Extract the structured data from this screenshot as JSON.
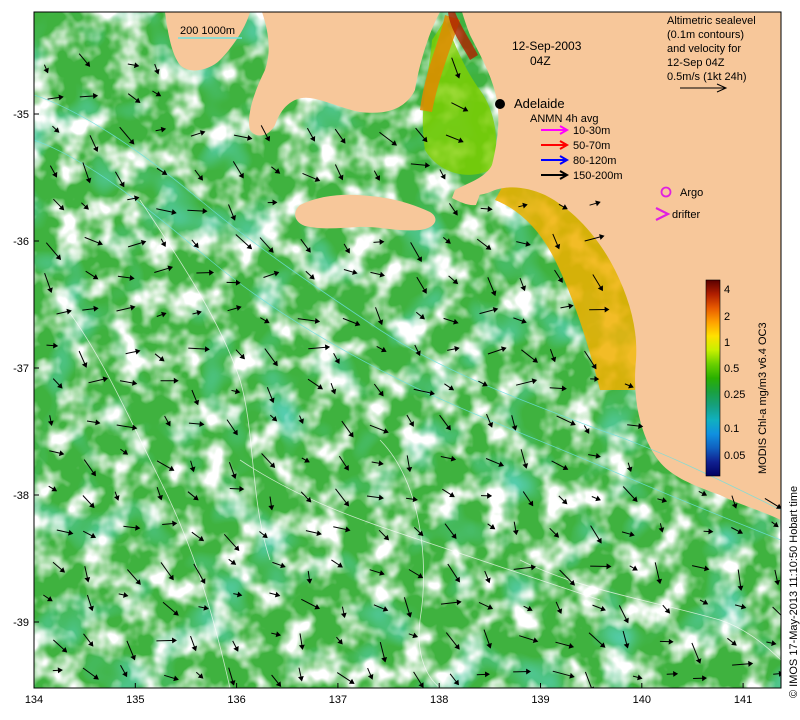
{
  "map": {
    "date": "12-Sep-2003",
    "time": "04Z",
    "city": "Adelaide",
    "scale_label": "200  1000m",
    "altimetry_note": [
      "Altimetric sealevel",
      "(0.1m contours)",
      "and velocity for",
      "12-Sep 04Z",
      "0.5m/s (1kt 24h)"
    ],
    "anmn": {
      "title": "ANMN 4h avg",
      "items": [
        {
          "label": "10-30m",
          "color": "#ff00ff"
        },
        {
          "label": "50-70m",
          "color": "#ff0000"
        },
        {
          "label": "80-120m",
          "color": "#0000ff"
        },
        {
          "label": "150-200m",
          "color": "#000000"
        }
      ]
    },
    "argo_label": "Argo",
    "drifter_label": "drifter",
    "colorbar": {
      "title": "MODIS Chl-a mg/m3 v6.4 OC3",
      "ticks": [
        "4",
        "2",
        "1",
        "0.5",
        "0.25",
        "0.1",
        "0.05"
      ],
      "colors": [
        "#5a0000",
        "#b01e00",
        "#e85a00",
        "#ffa000",
        "#ffe000",
        "#c8f000",
        "#6ad000",
        "#2ab000",
        "#1aa040",
        "#16a080",
        "#10b0c0",
        "#1090e0",
        "#1060c0",
        "#102090",
        "#000060"
      ]
    },
    "x_ticks": [
      "134",
      "135",
      "136",
      "137",
      "138",
      "139",
      "140",
      "141"
    ],
    "y_ticks": [
      "-35",
      "-36",
      "-37",
      "-38",
      "-39"
    ],
    "credit": "© IMOS 17-May-2013 11:10:50 Hobart time",
    "colors": {
      "land": "#f7c79a",
      "ocean": "#3fb23f",
      "no_data": "#ffffff",
      "shelf_high": "#f0b000"
    }
  }
}
